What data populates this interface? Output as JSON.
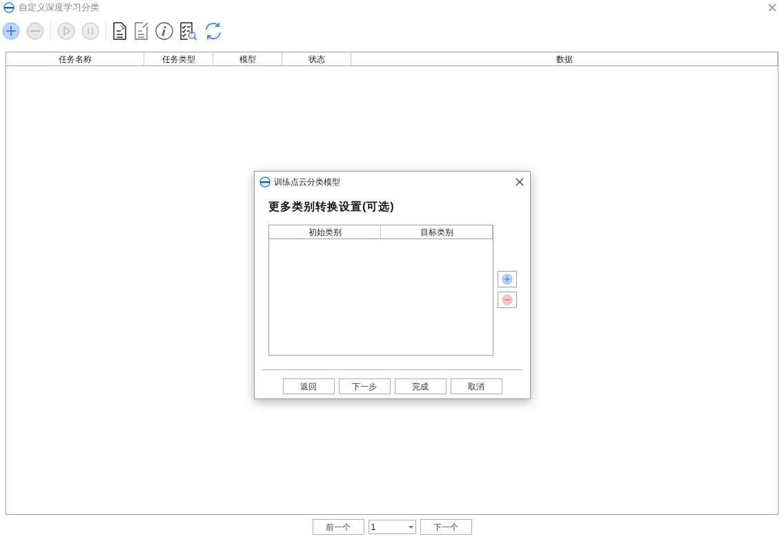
{
  "window": {
    "title": "自定义深度学习分类"
  },
  "toolbar": [
    {
      "kind": "add",
      "disabled": false
    },
    {
      "kind": "remove",
      "disabled": true
    },
    {
      "kind": "separator"
    },
    {
      "kind": "play",
      "disabled": true
    },
    {
      "kind": "pause",
      "disabled": true
    },
    {
      "kind": "separator"
    },
    {
      "kind": "import",
      "disabled": false
    },
    {
      "kind": "export",
      "disabled": true
    },
    {
      "kind": "info",
      "disabled": false
    },
    {
      "kind": "inspect",
      "disabled": false
    },
    {
      "kind": "refresh",
      "disabled": false
    }
  ],
  "table": {
    "columns": [
      "任务名称",
      "任务类型",
      "模型",
      "状态",
      "数据"
    ]
  },
  "pagination": {
    "prev": "前一个",
    "page": "1",
    "next": "下一个"
  },
  "dialog": {
    "title": "训练点云分类模型",
    "heading": "更多类别转换设置(可选)",
    "table": {
      "columns": [
        "初始类别",
        "目标类别"
      ]
    },
    "buttons": [
      "返回",
      "下一步",
      "完成",
      "取消"
    ]
  }
}
